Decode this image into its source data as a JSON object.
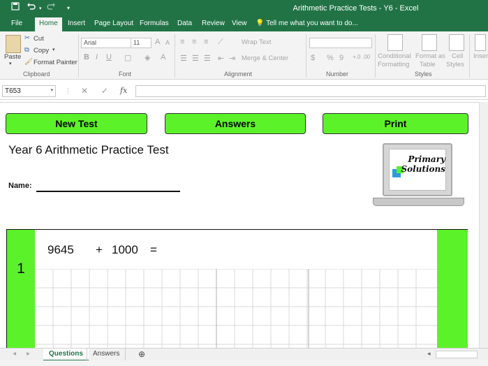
{
  "window": {
    "title": "Arithmetic Practice Tests - Y6 - Excel"
  },
  "ribbon_tabs": [
    "File",
    "Home",
    "Insert",
    "Page Layout",
    "Formulas",
    "Data",
    "Review",
    "View"
  ],
  "tell_me": "Tell me what you want to do...",
  "clipboard": {
    "paste": "Paste",
    "cut": "Cut",
    "copy": "Copy",
    "format_painter": "Format Painter",
    "label": "Clipboard"
  },
  "font": {
    "name": "Arial",
    "size": "11",
    "label": "Font",
    "bold": "B",
    "italic": "I",
    "underline": "U",
    "grow": "A",
    "shrink": "A"
  },
  "alignment": {
    "wrap_text": "Wrap Text",
    "merge_center": "Merge & Center",
    "label": "Alignment"
  },
  "number": {
    "label": "Number",
    "percent": "%",
    "comma": "9"
  },
  "styles": {
    "conditional": "Conditional",
    "conditional2": "Formatting",
    "format_as": "Format as",
    "table": "Table",
    "cell": "Cell",
    "cell_styles": "Styles",
    "label": "Styles"
  },
  "cells": {
    "insert": "Inser"
  },
  "formula_bar": {
    "name_box": "T653",
    "fx": "fx",
    "value": ""
  },
  "sheet": {
    "buttons": {
      "new_test": "New Test",
      "answers": "Answers",
      "print": "Print"
    },
    "title": "Year 6 Arithmetic Practice Test",
    "name_label": "Name:",
    "logo": {
      "line1": "Primary",
      "line2": "Solutions"
    },
    "question": {
      "number": "1",
      "operand1": "9645",
      "operator": "+",
      "operand2": "1000",
      "equals": "="
    }
  },
  "sheet_tabs": [
    "Questions",
    "Answers"
  ],
  "colors": {
    "excel_green": "#217346",
    "button_green": "#5cf22a"
  }
}
